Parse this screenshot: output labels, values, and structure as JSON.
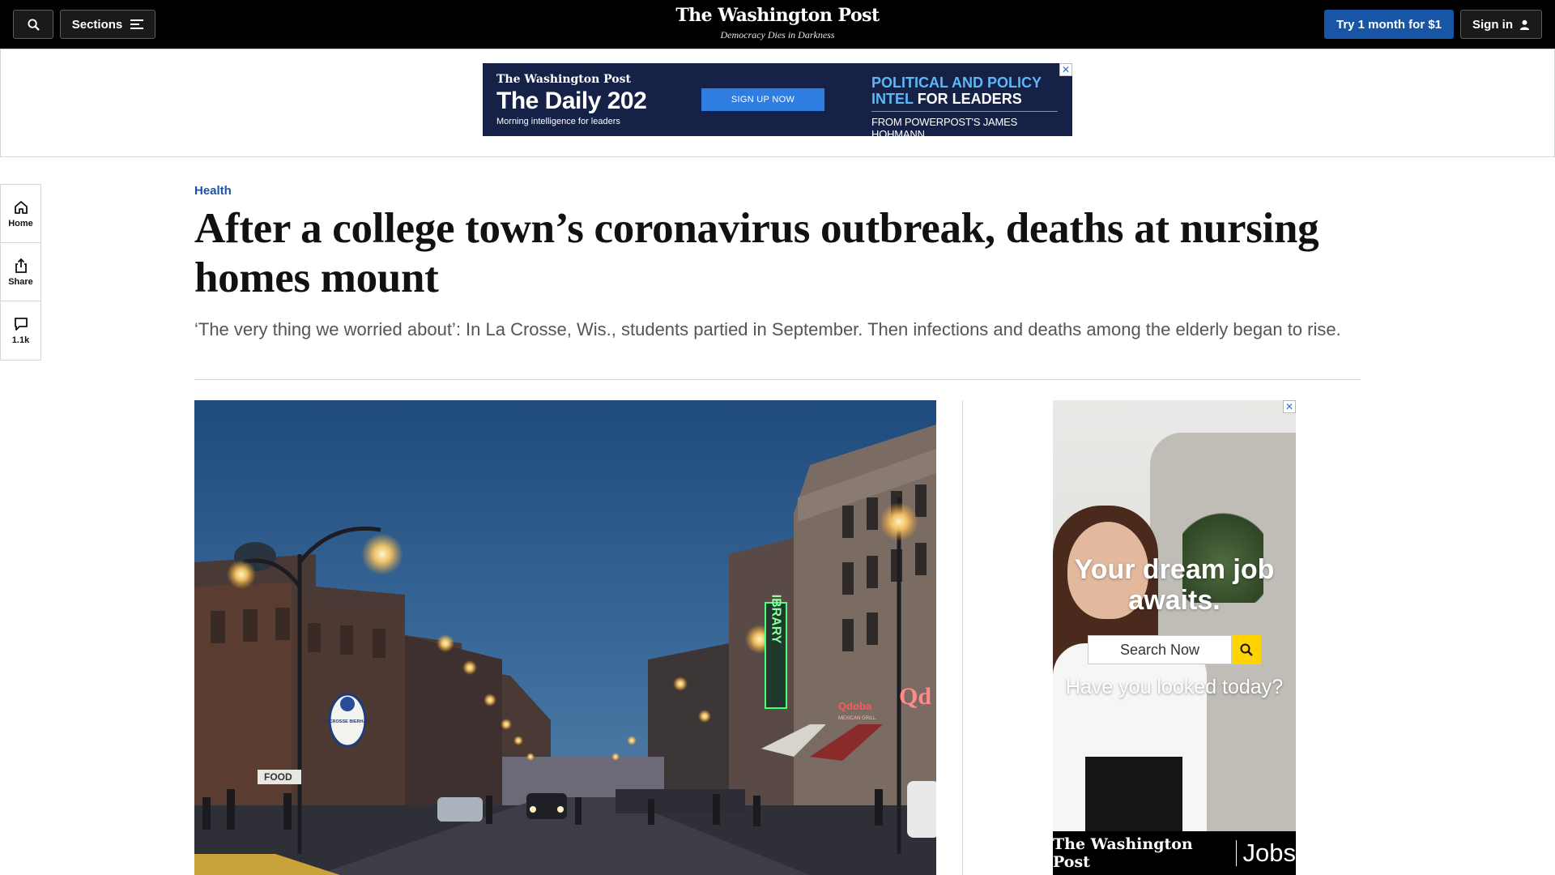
{
  "header": {
    "search_icon": "search-icon",
    "sections_label": "Sections",
    "logo": "The Washington Post",
    "tagline": "Democracy Dies in Darkness",
    "subscribe_label": "Try 1 month for $1",
    "signin_label": "Sign in",
    "accent": "#1955a5"
  },
  "top_ad": {
    "brand": "The Washington Post",
    "title": "The Daily 202",
    "subtitle": "Morning intelligence for leaders",
    "cta": "SIGN UP NOW",
    "headline_blue": "POLITICAL AND POLICY INTEL",
    "headline_white": "FOR LEADERS",
    "byline": "FROM POWERPOST'S JAMES HOHMANN",
    "close": "✕"
  },
  "rail": {
    "home": "Home",
    "share": "Share",
    "comments": "1.1k"
  },
  "article": {
    "kicker": "Health",
    "headline": "After a college town’s coronavirus outbreak, deaths at nursing homes mount",
    "dek": "‘The very thing we worried about’: In La Crosse, Wis., students partied in September. Then infections and deaths among the elderly began to rise."
  },
  "photo": {
    "sign_bierhaus": "LA CROSSE BIERHAUS",
    "sign_food": "FOOD",
    "sign_qdoba": "Qdoba",
    "sign_qdoba_sub": "MEXICAN GRILL",
    "sign_vertical": "IBRARY"
  },
  "side_ad": {
    "headline": "Your dream job awaits.",
    "search_label": "Search Now",
    "tagline": "Have you looked today?",
    "footer_brand": "The Washington Post",
    "footer_product": "Jobs",
    "close": "✕"
  }
}
